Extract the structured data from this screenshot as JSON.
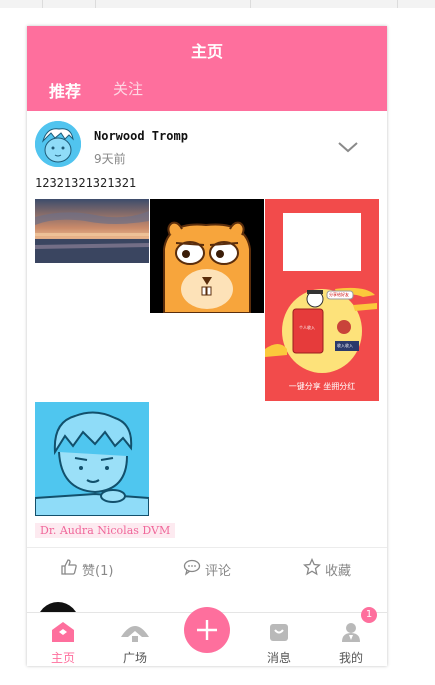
{
  "header": {
    "title": "主页",
    "tabs": [
      {
        "label": "推荐",
        "active": true
      },
      {
        "label": "关注",
        "active": false
      }
    ]
  },
  "post": {
    "author": "Norwood Tromp",
    "time": "9天前",
    "text": "12321321321321",
    "images": [
      {
        "name": "sunset-beach-photo"
      },
      {
        "name": "cartoon-hamster-photo"
      },
      {
        "name": "share-promo-poster",
        "caption": "一键分享 坐拥分红",
        "small_labels": [
          "个人收入",
          "收入收入",
          "分享给好友"
        ]
      },
      {
        "name": "cartoon-boy-laptop-photo"
      }
    ],
    "tag": "Dr. Audra Nicolas DVM",
    "actions": {
      "like": "赞(1)",
      "comment": "评论",
      "collect": "收藏"
    }
  },
  "tabbar": {
    "items": [
      {
        "label": "主页",
        "icon": "home-icon",
        "active": true
      },
      {
        "label": "广场",
        "icon": "fan-icon"
      },
      {
        "label": "",
        "icon": "plus-icon"
      },
      {
        "label": "消息",
        "icon": "bag-icon"
      },
      {
        "label": "我的",
        "icon": "user-icon"
      }
    ],
    "badge": "1"
  },
  "colors": {
    "brand": "#fe6f9d",
    "tag_bg": "#fdeaf0",
    "tag_text": "#f0679a"
  }
}
